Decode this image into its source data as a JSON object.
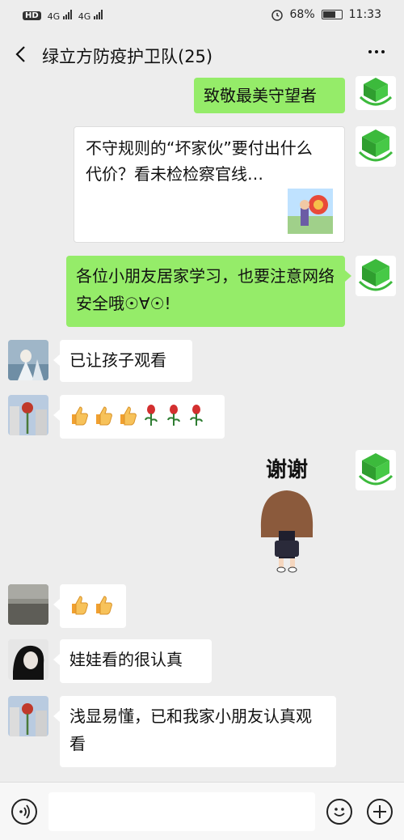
{
  "status_bar": {
    "hd_badge": "HD",
    "sim1_network": "4G",
    "sim2_network": "4G",
    "battery_percent": "68%",
    "battery_level": 0.68,
    "time": "11:33"
  },
  "header": {
    "title": "绿立方防疫护卫队(25)"
  },
  "messages": [
    {
      "text": "致敬最美守望者"
    },
    {
      "card_text": "不守规则的“坏家伙”要付出什么代价？看未检检察官线…"
    },
    {
      "text": "各位小朋友居家学习，也要注意网络安全哦☉∀☉!"
    },
    {
      "text": "已让孩子观看"
    },
    {
      "emoji_desc": "thumbs-up x3, rose x3"
    },
    {
      "sticker_text": "谢谢"
    },
    {
      "emoji_desc": "thumbs-up x2"
    },
    {
      "text": "娃娃看的很认真"
    },
    {
      "text": "浅显易懂，已和我家小朋友认真观看"
    }
  ],
  "input_bar": {
    "placeholder": ""
  },
  "icons": {
    "back": "back-arrow-icon",
    "more": "more-icon",
    "voice": "voice-icon",
    "emoji": "emoji-icon",
    "plus": "plus-icon"
  },
  "colors": {
    "outgoing_bubble": "#95ec69",
    "incoming_bubble": "#ffffff",
    "background": "#ededed"
  }
}
